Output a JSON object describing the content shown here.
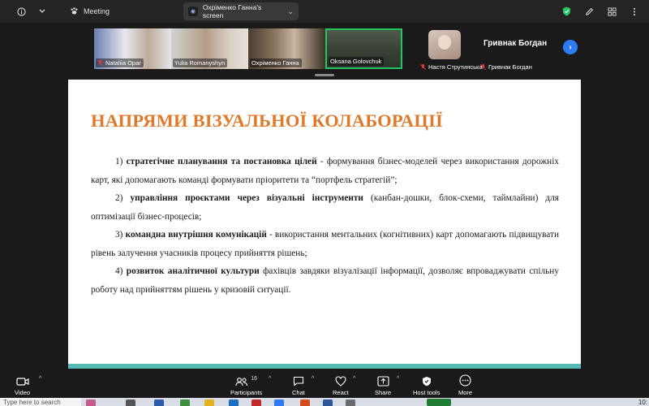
{
  "titlebar": {
    "meeting_label": "Meeting",
    "share_label": "Охріменко Ганна's screen",
    "info_icon": "info-icon",
    "shield_color": "#22c55e"
  },
  "participants": [
    {
      "name": "Nataliia Opar",
      "muted": true
    },
    {
      "name": "Yulia Romanyshyn",
      "muted": false
    },
    {
      "name": "Охріменко Ганна",
      "muted": false
    },
    {
      "name": "Oksana Golovchuk",
      "muted": false,
      "active_speaker": true
    },
    {
      "name": "Настя Струтинська",
      "muted": true
    },
    {
      "name": "Гривнак Богдан",
      "muted": true,
      "video_off": true
    }
  ],
  "slide": {
    "title": "НАПРЯМИ ВІЗУАЛЬНОЇ КОЛАБОРАЦІЇ",
    "items": [
      {
        "num": "1)",
        "bold": "стратегічне планування та постановка цілей",
        "rest": " - формування бізнес-моделей через використання дорожніх карт, які допомагають команді формувати пріоритети та “портфель стратегій”;"
      },
      {
        "num": "2)",
        "bold": "управління проєктами через візуальні інструменти",
        "rest": " (канбан-дошки, блок-схеми, таймлайни) для оптимізації бізнес-процесів;"
      },
      {
        "num": "3)",
        "bold": "командна внутрішня комунікацій",
        "rest": " - використання ментальних (когнітивних) карт допомагають підвищувати рівень залучення учасників процесу прийняття рішень;"
      },
      {
        "num": "4)",
        "bold": "розвиток аналітичної культури",
        "rest": " фахівців завдяки візуалізації інформації, дозволяє впроваджувати спільну роботу над прийняттям рішень у кризовій ситуації."
      }
    ],
    "accent_color": "#e07a2a",
    "bar_color": "#57bbb6"
  },
  "toolbar": {
    "video": "Video",
    "participants": "Participants",
    "participants_count": "16",
    "chat": "Chat",
    "react": "React",
    "share": "Share",
    "host_tools": "Host tools",
    "more": "More"
  },
  "taskbar": {
    "search_placeholder": "Type here to search",
    "clock": "10:"
  }
}
